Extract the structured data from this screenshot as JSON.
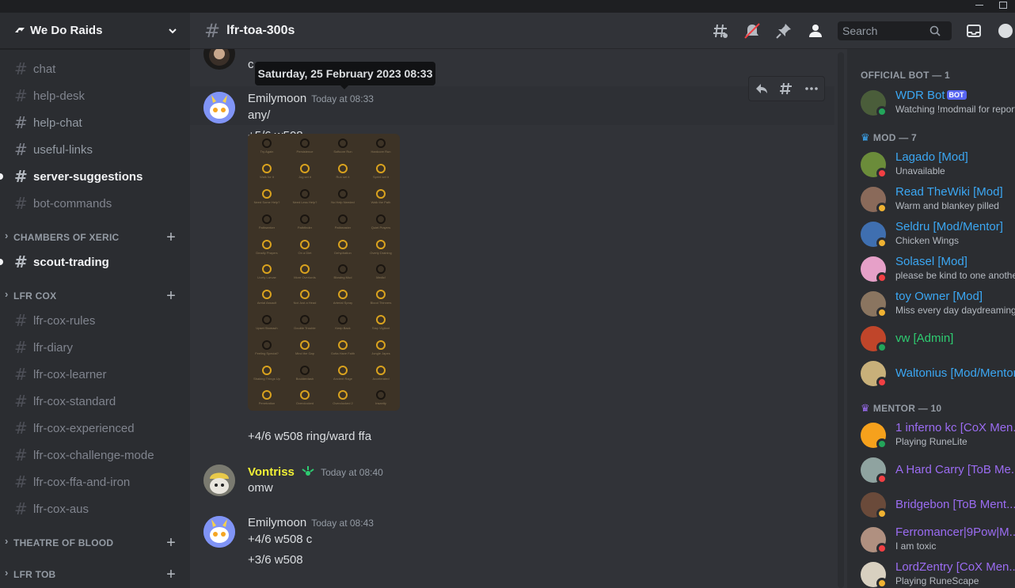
{
  "server": {
    "name": "We Do Raids"
  },
  "sidebar": {
    "top_channels": [
      {
        "name": "chat",
        "state": "muted"
      },
      {
        "name": "help-desk",
        "state": "muted"
      },
      {
        "name": "help-chat",
        "state": "normal"
      },
      {
        "name": "useful-links",
        "state": "normal"
      },
      {
        "name": "server-suggestions",
        "state": "unread"
      },
      {
        "name": "bot-commands",
        "state": "muted"
      }
    ],
    "categories": [
      {
        "name": "CHAMBERS OF XERIC",
        "channels": [
          {
            "name": "scout-trading",
            "state": "unread"
          }
        ]
      },
      {
        "name": "LFR COX",
        "channels": [
          {
            "name": "lfr-cox-rules",
            "state": "muted"
          },
          {
            "name": "lfr-diary",
            "state": "muted"
          },
          {
            "name": "lfr-cox-learner",
            "state": "muted"
          },
          {
            "name": "lfr-cox-standard",
            "state": "muted"
          },
          {
            "name": "lfr-cox-experienced",
            "state": "muted"
          },
          {
            "name": "lfr-cox-challenge-mode",
            "state": "muted"
          },
          {
            "name": "lfr-cox-ffa-and-iron",
            "state": "muted"
          },
          {
            "name": "lfr-cox-aus",
            "state": "muted"
          }
        ]
      },
      {
        "name": "THEATRE OF BLOOD",
        "channels": []
      },
      {
        "name": "LFR TOB",
        "channels": []
      }
    ]
  },
  "header": {
    "channel_name": "lfr-toa-300s",
    "search_placeholder": "Search"
  },
  "tooltip": "Saturday, 25 February 2023 08:33",
  "messages": [
    {
      "id": "m0",
      "author": "",
      "ts": "",
      "lines": [
        "c"
      ]
    },
    {
      "id": "m1",
      "author": "Emilymoon",
      "ts": "Today at 08:33",
      "lines": [
        "any/",
        "+5/6 w508",
        "+4/6 w508 ring/ward ffa"
      ]
    },
    {
      "id": "m2",
      "author": "Vontriss",
      "ts": "Today at 08:40",
      "lines": [
        "omw"
      ]
    },
    {
      "id": "m3",
      "author": "Emilymoon",
      "ts": "Today at 08:43",
      "lines": [
        "+4/6 w508 c",
        "+3/6 w508"
      ]
    }
  ],
  "loot_grid": [
    "Try Again",
    "Persistence",
    "Softcore Run",
    "Hardcore Run",
    "Walk for it",
    "Jog set it",
    "Run set it",
    "Sprint set it",
    "Need Some Help?",
    "Need Less Help?",
    "No Help Needed",
    "Walk the Path",
    "Pathseeker",
    "Pathfinder",
    "Pathmaster",
    "Quiet Prayers",
    "Deadly Prayers",
    "On a Diet",
    "Dehydration",
    "Overly Draining",
    "Lively Larvae",
    "More Overlords",
    "Blowing Mud",
    "Medic!",
    "Aerial Assault",
    "Not Just a Head",
    "Arterial Spray",
    "Blood Thinners",
    "Upset Stomach",
    "Double Trouble",
    "Keep Back",
    "Stay Vigilant",
    "Feeling Special?",
    "Mind the Gap",
    "Gotta Have Faith",
    "Jungle Japes",
    "Shaking Things Up",
    "Boulderdash",
    "Ancient Rage",
    "Accelerated",
    "Penetration",
    "Overclocked",
    "Overclocked 2",
    "Insanity"
  ],
  "members": {
    "groups": [
      {
        "title": "OFFICIAL BOT — 1",
        "items": [
          {
            "name": "WDR Bot",
            "tag": "BOT",
            "status": "Watching !modmail for reports",
            "presence": "online",
            "color": "#3ba7f3"
          }
        ]
      },
      {
        "title": "MOD — 7",
        "items": [
          {
            "name": "Lagado [Mod]",
            "status": "Unavailable",
            "presence": "dnd",
            "color": "#3ba7f3"
          },
          {
            "name": "Read TheWiki [Mod]",
            "status": "Warm and blankey pilled",
            "presence": "idle",
            "color": "#3ba7f3"
          },
          {
            "name": "Seldru [Mod/Mentor]",
            "status": "Chicken Wings",
            "presence": "idle",
            "color": "#3ba7f3"
          },
          {
            "name": "Solasel [Mod]",
            "status": "please be kind to one another",
            "presence": "dnd",
            "color": "#3ba7f3"
          },
          {
            "name": "toy Owner [Mod]",
            "status": "Miss every day daydreaming",
            "presence": "idle",
            "color": "#3ba7f3"
          },
          {
            "name": "vw [Admin]",
            "status": "",
            "presence": "online",
            "color": "#2ecc71"
          },
          {
            "name": "Waltonius [Mod/Mentor]",
            "status": "",
            "presence": "dnd",
            "color": "#3ba7f3"
          }
        ]
      },
      {
        "title": "MENTOR — 10",
        "items": [
          {
            "name": "1 inferno kc [CoX Men...",
            "status": "Playing RuneLite",
            "presence": "online",
            "color": "#9b6cf2"
          },
          {
            "name": "A Hard Carry [ToB Me...",
            "status": "",
            "presence": "dnd",
            "color": "#9b6cf2"
          },
          {
            "name": "Bridgebon [ToB Ment...",
            "status": "",
            "presence": "idle",
            "color": "#9b6cf2"
          },
          {
            "name": "Ferromancer|9Pow|M...",
            "status": "I am toxic",
            "presence": "dnd",
            "color": "#9b6cf2"
          },
          {
            "name": "LordZentry [CoX Men...",
            "status": "Playing RuneScape",
            "presence": "idle",
            "color": "#9b6cf2"
          }
        ]
      }
    ]
  },
  "colors": {
    "emilymoon": "#dbdee1",
    "vontriss": "#f1c40f"
  }
}
